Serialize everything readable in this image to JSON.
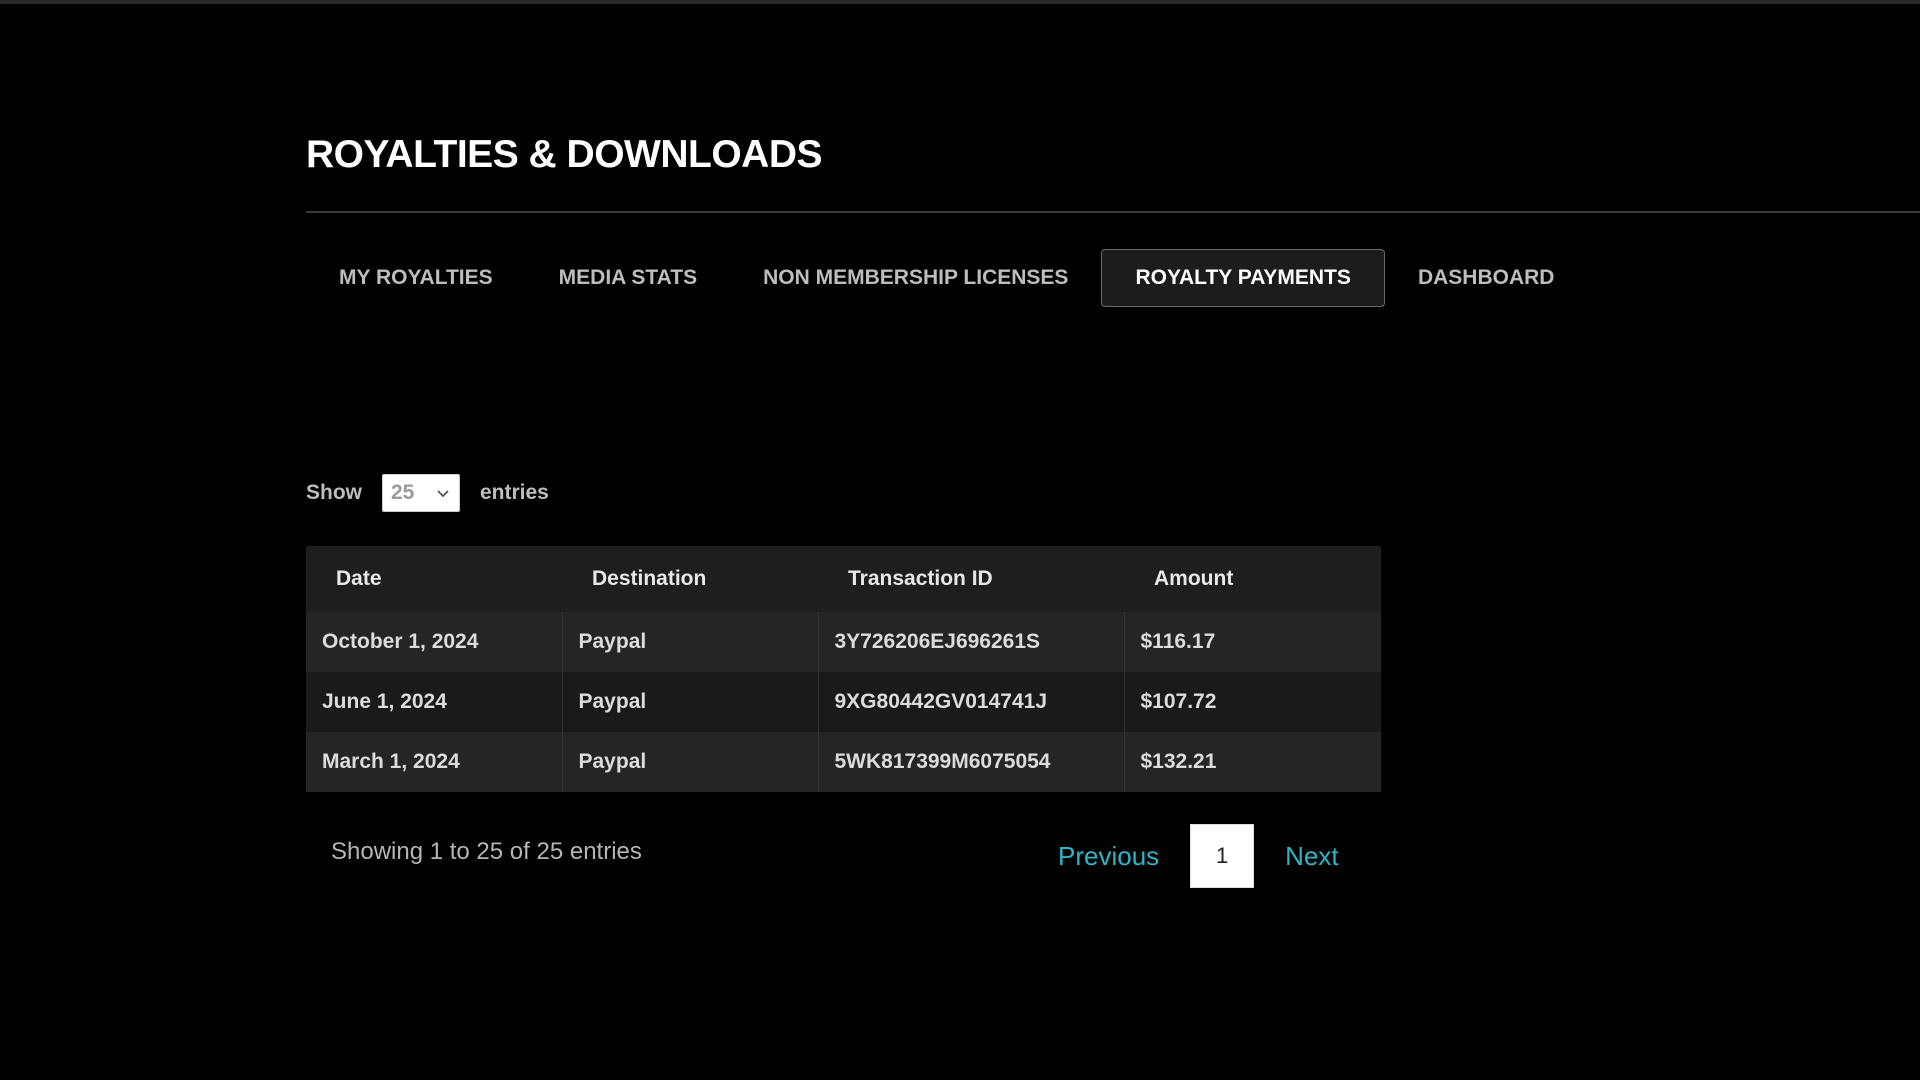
{
  "header": {
    "title": "ROYALTIES & DOWNLOADS"
  },
  "tabs": [
    {
      "label": "MY ROYALTIES",
      "active": false
    },
    {
      "label": "MEDIA STATS",
      "active": false
    },
    {
      "label": "NON MEMBERSHIP LICENSES",
      "active": false
    },
    {
      "label": "ROYALTY PAYMENTS",
      "active": true
    },
    {
      "label": "DASHBOARD",
      "active": false
    }
  ],
  "length_control": {
    "prefix": "Show",
    "selected": "25",
    "suffix": "entries",
    "icon": "chevron-down-icon"
  },
  "table": {
    "headers": [
      "Date",
      "Destination",
      "Transaction ID",
      "Amount"
    ],
    "rows": [
      [
        "October 1, 2024",
        "Paypal",
        "3Y726206EJ696261S",
        "$116.17"
      ],
      [
        "June 1, 2024",
        "Paypal",
        "9XG80442GV014741J",
        "$107.72"
      ],
      [
        "March 1, 2024",
        "Paypal",
        "5WK817399M6075054",
        "$132.21"
      ]
    ]
  },
  "footer": {
    "info": "Showing 1 to 25 of 25 entries",
    "previous": "Previous",
    "current_page": "1",
    "next": "Next"
  },
  "colors": {
    "background": "#000000",
    "link": "#2fb5c4",
    "active_tab_bg": "#1c1c1c"
  }
}
